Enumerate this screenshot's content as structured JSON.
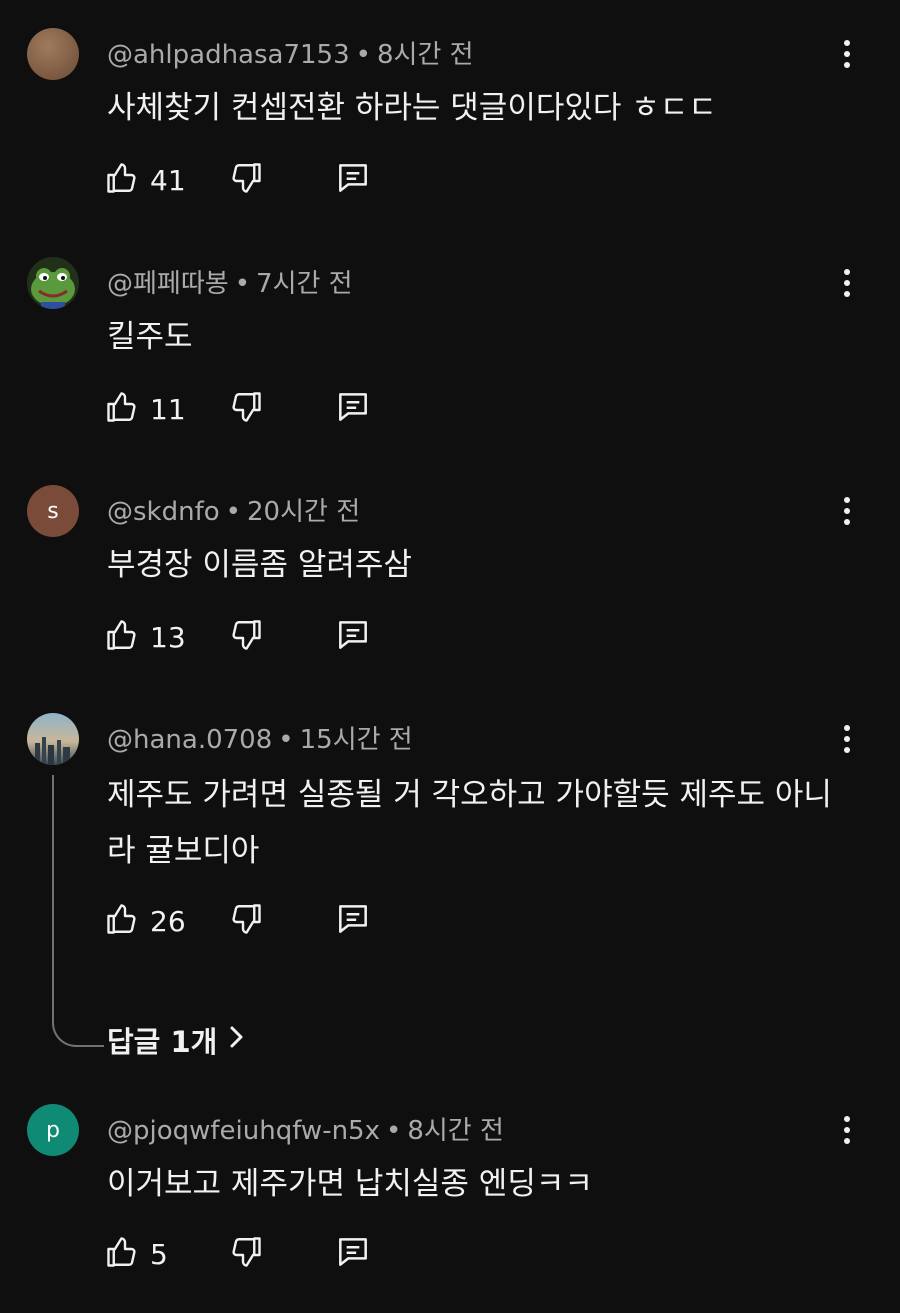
{
  "comments": [
    {
      "author": "@ahlpadhasa7153",
      "time": "8시간 전",
      "text": "사체찾기 컨셉전환 하라는 댓글이다있다 ㅎㄷㄷ",
      "likes": "41",
      "avatar_color": "#7a5a44"
    },
    {
      "author": "@페페따봉",
      "time": "7시간 전",
      "text": "킬주도",
      "likes": "11",
      "avatar_color": "#4e8a3a"
    },
    {
      "author": "@skdnfo",
      "time": "20시간 전",
      "text": "부경장 이름좀 알려주삼",
      "likes": "13",
      "avatar_letter": "s",
      "avatar_color": "#7b4b3a"
    },
    {
      "author": "@hana.0708",
      "time": "15시간 전",
      "text": "제주도 가려면 실종될 거 각오하고 가야할듯 제주도 아니라 귤보디아",
      "likes": "26",
      "replies": "답글 1개",
      "avatar_color": "#6f8ca0"
    },
    {
      "author": "@pjoqwfeiuhqfw-n5x",
      "time": "8시간 전",
      "text": "이거보고 제주가면 납치실종 엔딩ㅋㅋ",
      "likes": "5",
      "avatar_letter": "p",
      "avatar_color": "#0f8a74"
    }
  ],
  "meta_separator": "•",
  "icons": {
    "like": "thumbs-up-icon",
    "dislike": "thumbs-down-icon",
    "reply": "comment-icon",
    "menu": "more-vert-icon",
    "chevron": "chevron-right-icon"
  }
}
